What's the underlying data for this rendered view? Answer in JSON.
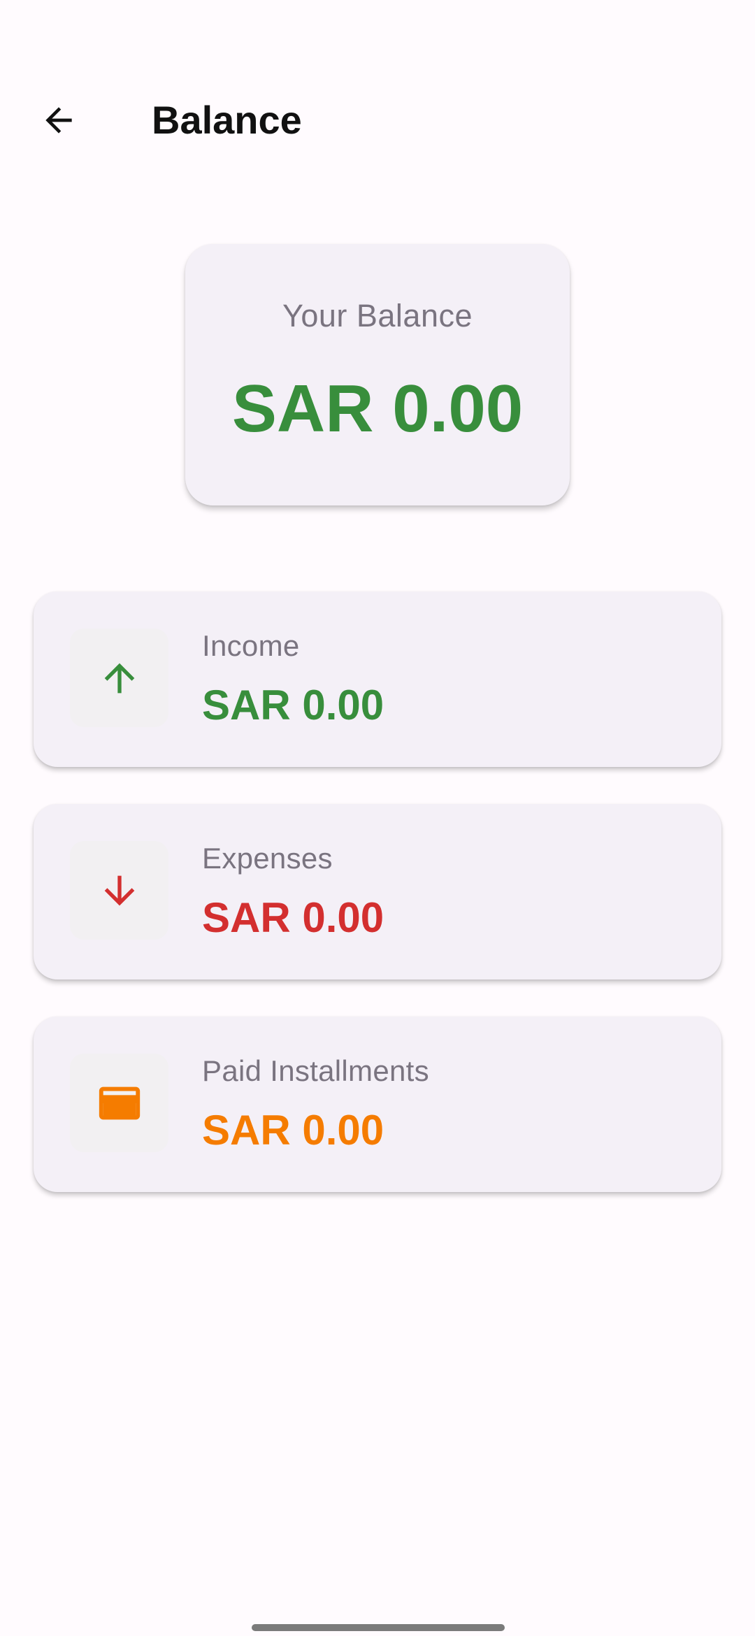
{
  "header": {
    "title": "Balance",
    "back_icon": "arrow-left-icon"
  },
  "balance": {
    "label": "Your Balance",
    "value": "SAR 0.00",
    "color": "#388e3c"
  },
  "stats": [
    {
      "label": "Income",
      "value": "SAR 0.00",
      "icon": "arrow-up-icon",
      "color": "#388e3c"
    },
    {
      "label": "Expenses",
      "value": "SAR 0.00",
      "icon": "arrow-down-icon",
      "color": "#d32f2f"
    },
    {
      "label": "Paid Installments",
      "value": "SAR 0.00",
      "icon": "credit-card-icon",
      "color": "#f57c00"
    }
  ]
}
